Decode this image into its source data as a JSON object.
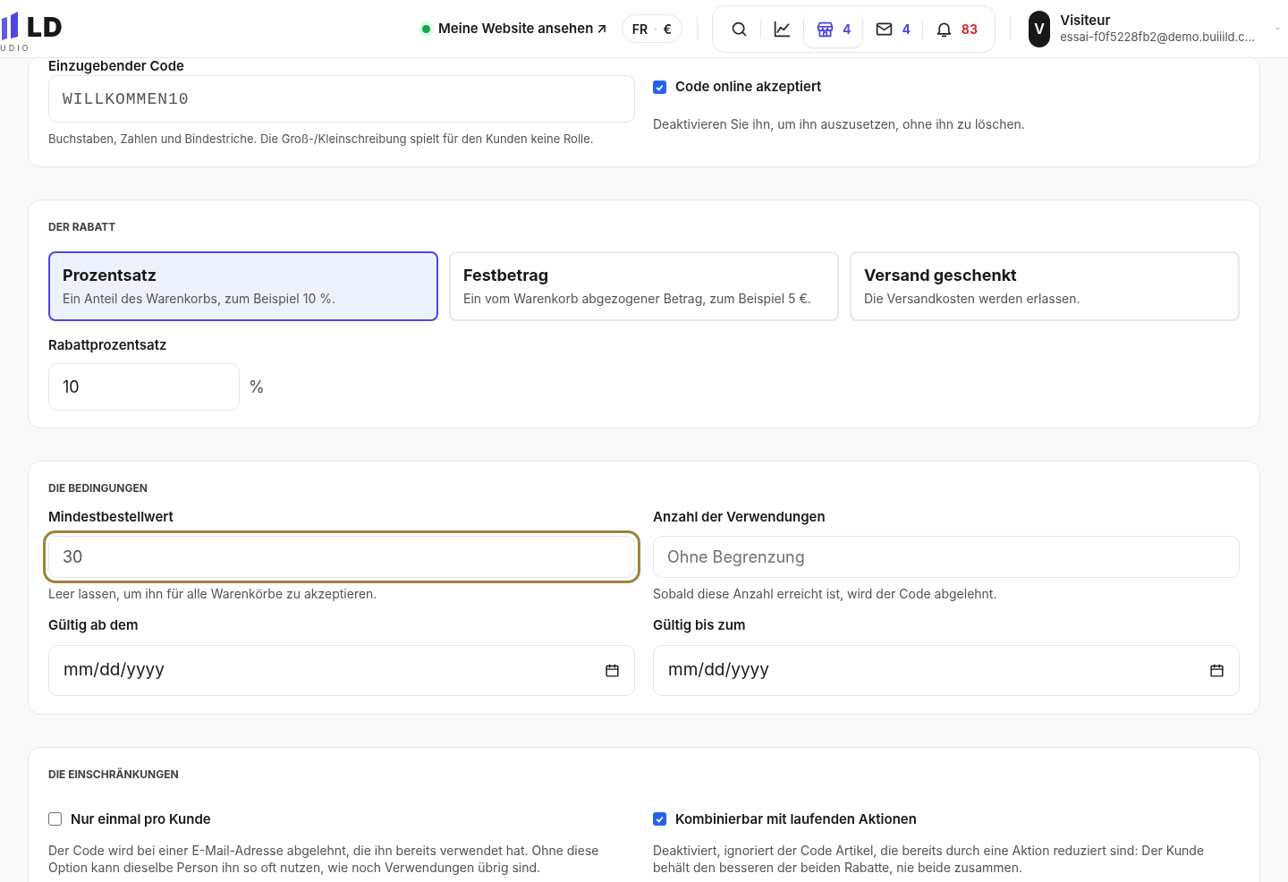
{
  "header": {
    "logo": {
      "mark": "LD",
      "sub": "UDIO"
    },
    "site_link": "Meine Website ansehen ↗",
    "locale": {
      "language": "FR",
      "separator": "·",
      "currency": "€"
    },
    "toolbar": [
      {
        "kind": "search",
        "selected": false
      },
      {
        "kind": "chart",
        "selected": false
      },
      {
        "kind": "store",
        "selected": true,
        "count": "4",
        "color": "#4f46e5"
      },
      {
        "kind": "mail",
        "selected": false,
        "count": "4",
        "color": "#4f46e5"
      },
      {
        "kind": "bell",
        "selected": false,
        "count": "83",
        "color": "#dc2626"
      }
    ],
    "user": {
      "initial": "V",
      "name": "Visiteur",
      "email": "essai-f0f5228fb2@demo.buiiild.c..."
    }
  },
  "code_section": {
    "label": "Einzugebender Code",
    "value": "WILLKOMMEN10",
    "help": "Buchstaben, Zahlen und Bindestriche. Die Groß-/Kleinschreibung spielt für den Kunden keine Rolle.",
    "online": {
      "label": "Code online akzeptiert",
      "checked": true,
      "help": "Deaktivieren Sie ihn, um ihn auszusetzen, ohne ihn zu löschen."
    }
  },
  "discount": {
    "title": "DER RABATT",
    "options": [
      {
        "title": "Prozentsatz",
        "description": "Ein Anteil des Warenkorbs, zum Beispiel 10 %.",
        "selected": true
      },
      {
        "title": "Festbetrag",
        "description": "Ein vom Warenkorb abgezogener Betrag, zum Beispiel 5 €.",
        "selected": false
      },
      {
        "title": "Versand geschenkt",
        "description": "Die Versandkosten werden erlassen.",
        "selected": false
      }
    ],
    "rate": {
      "label": "Rabattprozentsatz",
      "value": "10",
      "unit": "%"
    }
  },
  "conditions": {
    "title": "DIE BEDINGUNGEN",
    "fields": [
      {
        "label": "Mindestbestellwert",
        "value": "30",
        "focused": true,
        "help": "Leer lassen, um ihn für alle Warenkörbe zu akzeptieren."
      },
      {
        "label": "Anzahl der Verwendungen",
        "placeholder": "Ohne Begrenzung",
        "focused": false,
        "help": "Sobald diese Anzahl erreicht ist, wird der Code abgelehnt."
      },
      {
        "label": "Gültig ab dem",
        "placeholder": "mm/dd/yyyy",
        "kind": "date"
      },
      {
        "label": "Gültig bis zum",
        "placeholder": "mm/dd/yyyy",
        "kind": "date"
      }
    ]
  },
  "restrictions": {
    "title": "DIE EINSCHRÄNKUNGEN",
    "options": [
      {
        "label": "Nur einmal pro Kunde",
        "checked": false,
        "help": "Der Code wird bei einer E-Mail-Adresse abgelehnt, die ihn bereits verwendet hat. Ohne diese Option kann dieselbe Person ihn so oft nutzen, wie noch Verwendungen übrig sind."
      },
      {
        "label": "Kombinierbar mit laufenden Aktionen",
        "checked": true,
        "help": "Deaktiviert, ignoriert der Code Artikel, die bereits durch eine Aktion reduziert sind: Der Kunde behält den besseren der beiden Rabatte, nie beide zusammen."
      }
    ]
  }
}
